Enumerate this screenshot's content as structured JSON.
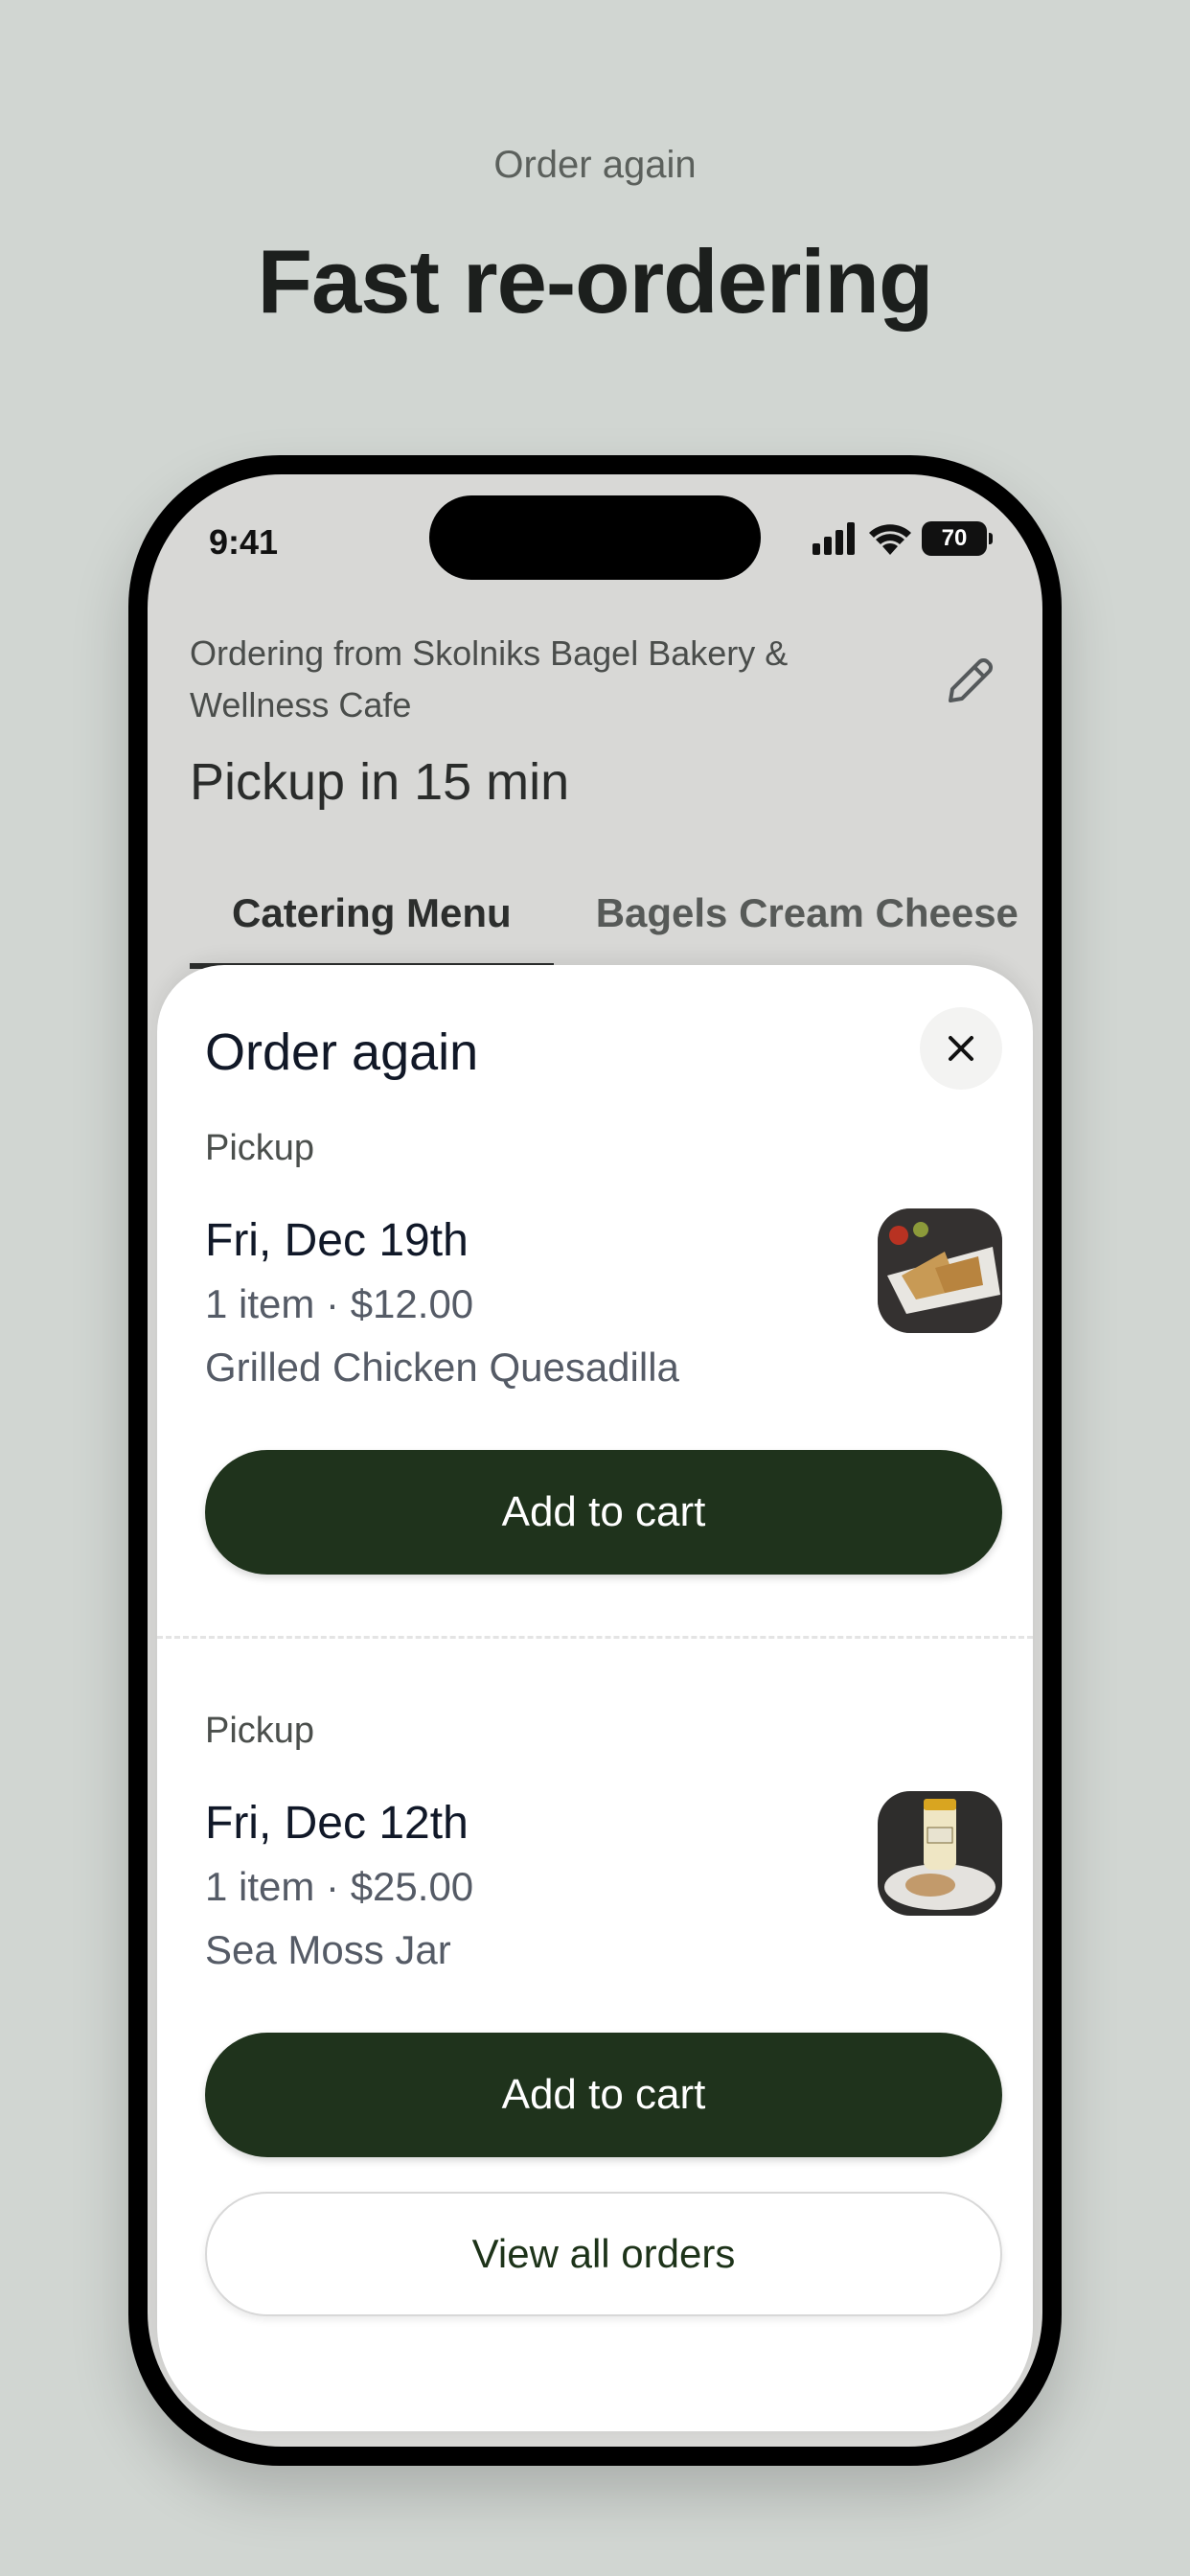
{
  "promo": {
    "kicker": "Order again",
    "headline": "Fast re-ordering"
  },
  "status_bar": {
    "time": "9:41",
    "battery": "70"
  },
  "header": {
    "store_line": "Ordering from Skolniks Bagel Bakery & Wellness Cafe",
    "pickup": "Pickup in 15 min"
  },
  "tabs": [
    {
      "label": "Catering Menu",
      "active": true
    },
    {
      "label": "Bagels Cream Cheese",
      "active": false
    }
  ],
  "sheet": {
    "title": "Order again",
    "orders": [
      {
        "type": "Pickup",
        "date": "Fri, Dec 19th",
        "summary": "1 item · $12.00",
        "item": "Grilled Chicken Quesadilla",
        "button": "Add to cart"
      },
      {
        "type": "Pickup",
        "date": "Fri, Dec 12th",
        "summary": "1 item · $25.00",
        "item": "Sea Moss Jar",
        "button": "Add to cart"
      }
    ],
    "view_all": "View all orders"
  },
  "colors": {
    "background": "#d1d6d2",
    "primary_button": "#1f331c",
    "headline": "#1c1f1d"
  }
}
